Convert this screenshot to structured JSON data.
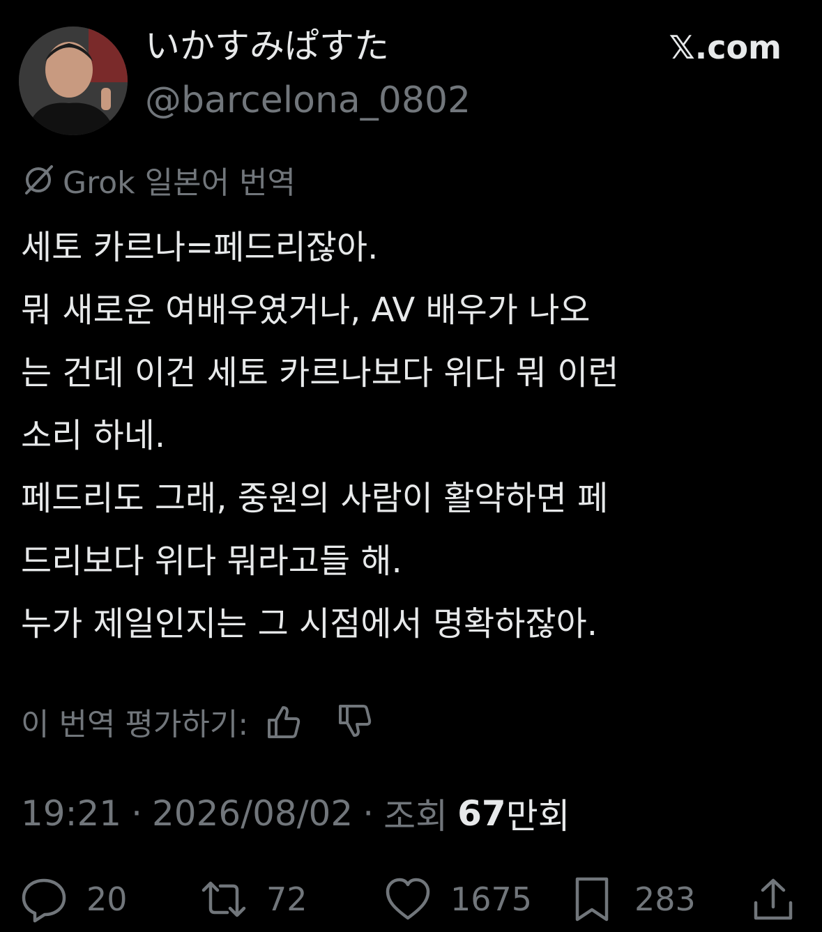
{
  "header": {
    "display_name": "いかすみぱすた",
    "handle": "@barcelona_0802",
    "site_label": "𝕏.com"
  },
  "translation": {
    "label": "Grok 일본어 번역",
    "icon": "grok-icon"
  },
  "post": {
    "lines": [
      "세토 카르나=페드리잖아.",
      "뭐 새로운 여배우였거나, AV 배우가 나오",
      "는 건데 이건 세토 카르나보다 위다 뭐 이런",
      "소리 하네.",
      "페드리도 그래, 중원의 사람이 활약하면 페",
      "드리보다 위다 뭐라고들 해.",
      "누가 제일인지는 그 시점에서 명확하잖아."
    ]
  },
  "rating": {
    "label": "이 번역 평가하기:"
  },
  "meta": {
    "time": "19:21",
    "separator": "·",
    "date": "2026/08/02",
    "views_label": "조회",
    "views_count": "67",
    "views_unit": "만회"
  },
  "actions": {
    "replies": "20",
    "reposts": "72",
    "likes": "1675",
    "bookmarks": "283"
  },
  "colors": {
    "background": "#000000",
    "text": "#e7e9ea",
    "muted": "#71767b"
  }
}
